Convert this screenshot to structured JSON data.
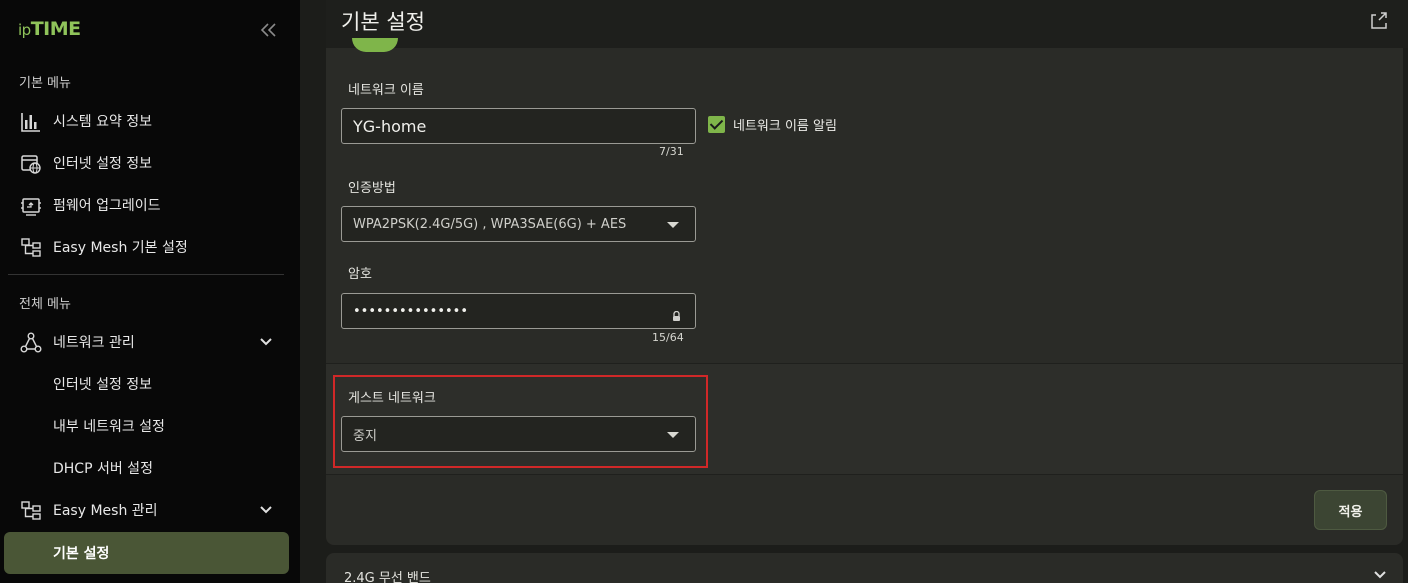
{
  "app": {
    "logo_small": "ip",
    "logo_large": "TIME"
  },
  "sidebar": {
    "basic_menu_title": "기본 메뉴",
    "basic_items": [
      {
        "label": "시스템 요약 정보",
        "icon": "bar-chart-icon"
      },
      {
        "label": "인터넷 설정 정보",
        "icon": "globe-window-icon"
      },
      {
        "label": "펌웨어 업그레이드",
        "icon": "firmware-icon"
      },
      {
        "label": "Easy Mesh 기본 설정",
        "icon": "mesh-icon"
      }
    ],
    "all_menu_title": "전체 메뉴",
    "all_items": [
      {
        "label": "네트워크 관리",
        "icon": "network-icon",
        "expandable": true
      },
      {
        "label": "인터넷 설정 정보"
      },
      {
        "label": "내부 네트워크 설정"
      },
      {
        "label": "DHCP 서버 설정"
      },
      {
        "label": "Easy Mesh 관리",
        "icon": "mesh-icon",
        "expandable": true
      },
      {
        "label": "기본 설정",
        "active": true
      }
    ]
  },
  "header": {
    "title": "기본 설정"
  },
  "form": {
    "network_name_label": "네트워크 이름",
    "network_name_value": "YG-home",
    "network_name_counter": "7/31",
    "broadcast_label": "네트워크 이름 알림",
    "auth_label": "인증방법",
    "auth_value": "WPA2PSK(2.4G/5G) , WPA3SAE(6G) + AES",
    "password_label": "암호",
    "password_value": "•••••••••••••••",
    "password_counter": "15/64",
    "guest_label": "게스트 네트워크",
    "guest_value": "중지",
    "apply_label": "적용"
  },
  "next_section": {
    "title": "2.4G 무선 밴드"
  },
  "colors": {
    "accent": "#7fb54a",
    "highlight": "#d02828",
    "active_bg": "#4a5636"
  }
}
